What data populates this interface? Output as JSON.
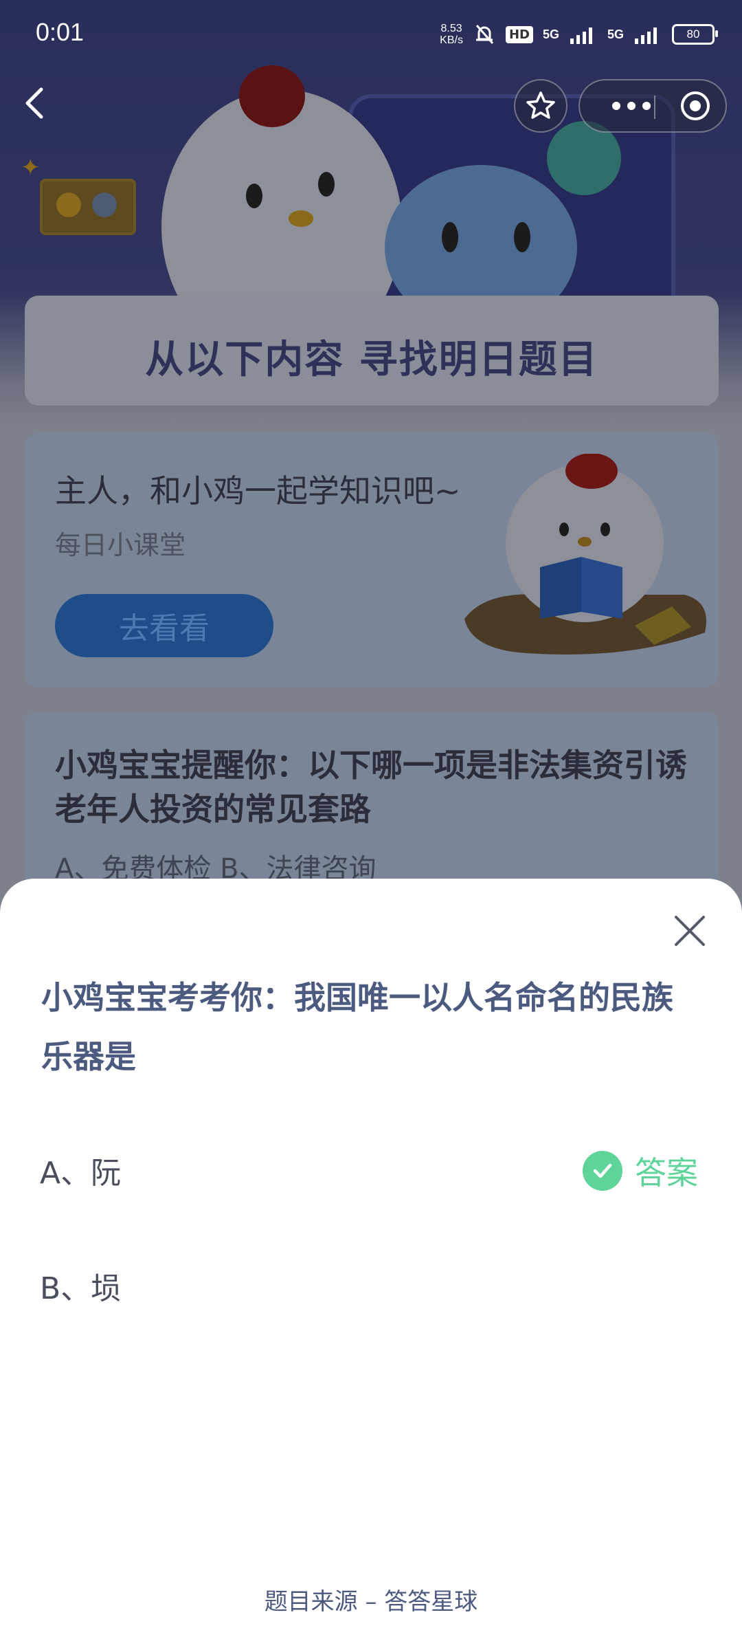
{
  "status_bar": {
    "time": "0:01",
    "net_speed_value": "8.53",
    "net_speed_unit": "KB/s",
    "hd_label": "HD",
    "signal1": "5G",
    "signal2": "5G",
    "battery": "80"
  },
  "header": {
    "banner_title": "从以下内容 寻找明日题目"
  },
  "learn_card": {
    "heading": "主人，和小鸡一起学知识吧~",
    "subheading": "每日小课堂",
    "button_label": "去看看"
  },
  "quiz_card": {
    "question": "小鸡宝宝提醒你：以下哪一项是非法集资引诱老年人投资的常见套路",
    "options_preview": "A、免费体检    B、法律咨询"
  },
  "sheet": {
    "question": "小鸡宝宝考考你：我国唯一以人名命名的民族乐器是",
    "options": [
      {
        "label": "A、阮"
      },
      {
        "label": "B、埙"
      }
    ],
    "answer_label": "答案",
    "footer": "题目来源 – 答答星球"
  },
  "colors": {
    "accent_green": "#5fd49a",
    "question_blue": "#4c5a80"
  }
}
